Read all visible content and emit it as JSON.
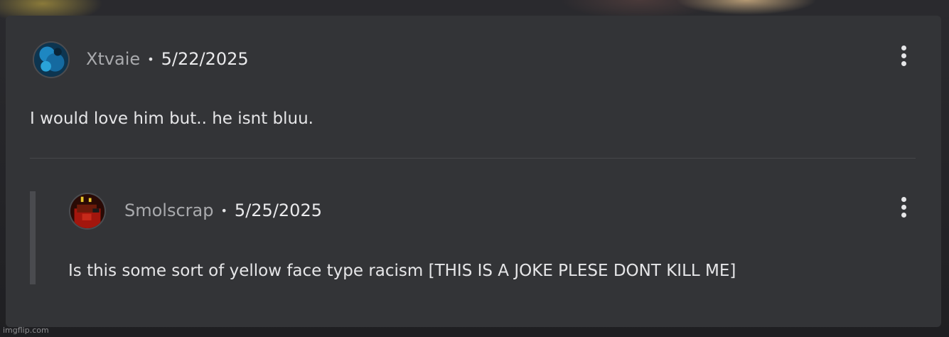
{
  "comment": {
    "username": "Xtvaie",
    "separator": "•",
    "date": "5/22/2025",
    "text": "I would love him but.. he isnt bluu."
  },
  "reply": {
    "username": "Smolscrap",
    "separator": "•",
    "date": "5/25/2025",
    "text": "Is this some sort of yellow face type racism [THIS IS A JOKE PLESE DONT KILL ME]"
  },
  "watermark": "imgflip.com",
  "colors": {
    "card": "#333437",
    "text": "#e6e6e8",
    "username": "#a9aaad",
    "divider": "#46474b"
  },
  "icons": {
    "more": "more-vertical-icon"
  }
}
